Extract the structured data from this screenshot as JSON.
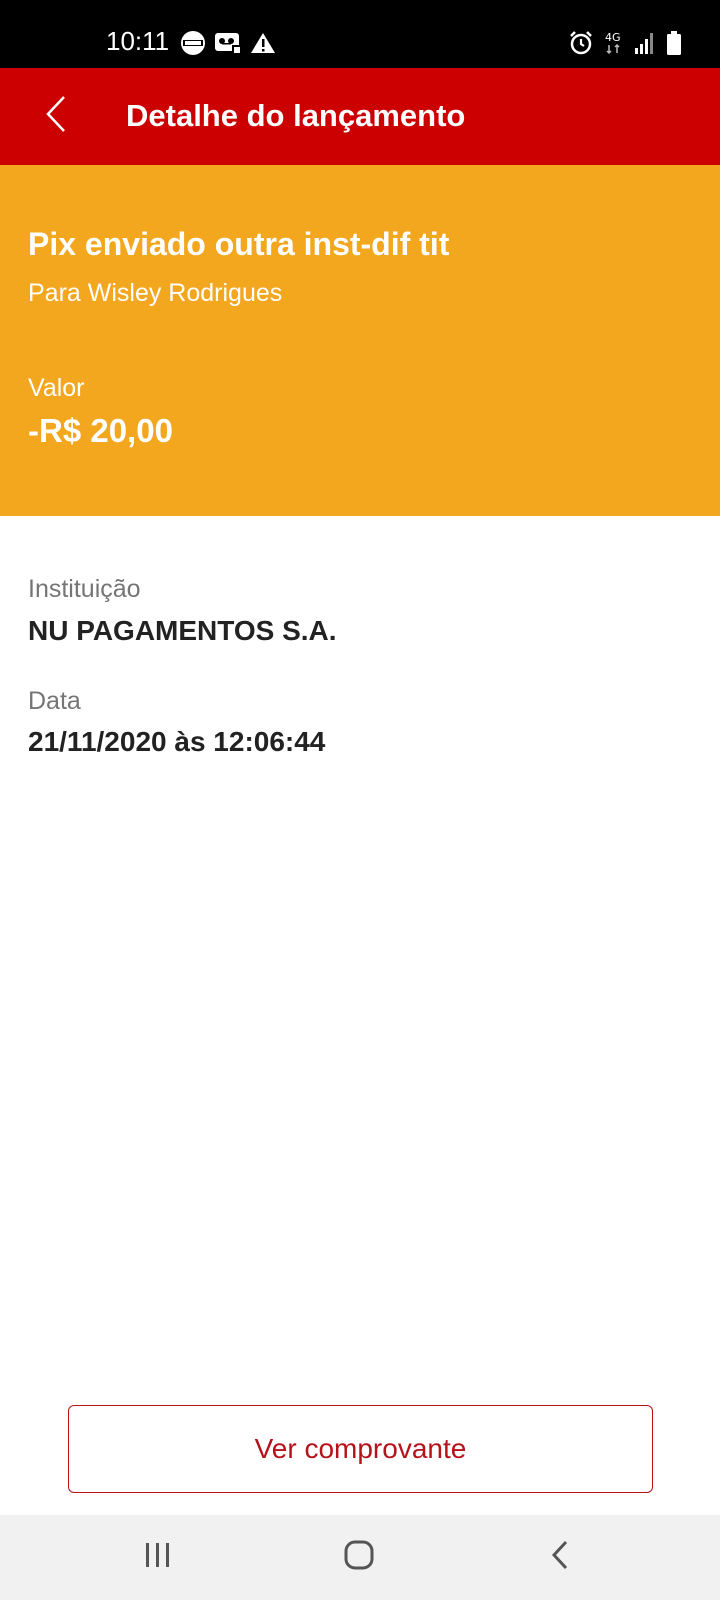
{
  "status_bar": {
    "time": "10:11",
    "left_icons": [
      "365-badge-icon",
      "voicemail-icon",
      "warning-icon"
    ],
    "right_icons": [
      "alarm-icon",
      "network-4g-icon",
      "signal-icon",
      "battery-icon"
    ],
    "network_label": "4G"
  },
  "header": {
    "title": "Detalhe do lançamento"
  },
  "summary": {
    "title": "Pix enviado outra inst-dif tit",
    "subtitle": "Para Wisley Rodrigues",
    "value_label": "Valor",
    "value": "-R$ 20,00"
  },
  "details": [
    {
      "label": "Instituição",
      "value": "NU PAGAMENTOS S.A."
    },
    {
      "label": "Data",
      "value": "21/11/2020 às 12:06:44"
    }
  ],
  "actions": {
    "receipt_button_label": "Ver comprovante"
  },
  "colors": {
    "header_red": "#cc0000",
    "summary_orange": "#f2a71f",
    "button_red": "#b5121b"
  }
}
